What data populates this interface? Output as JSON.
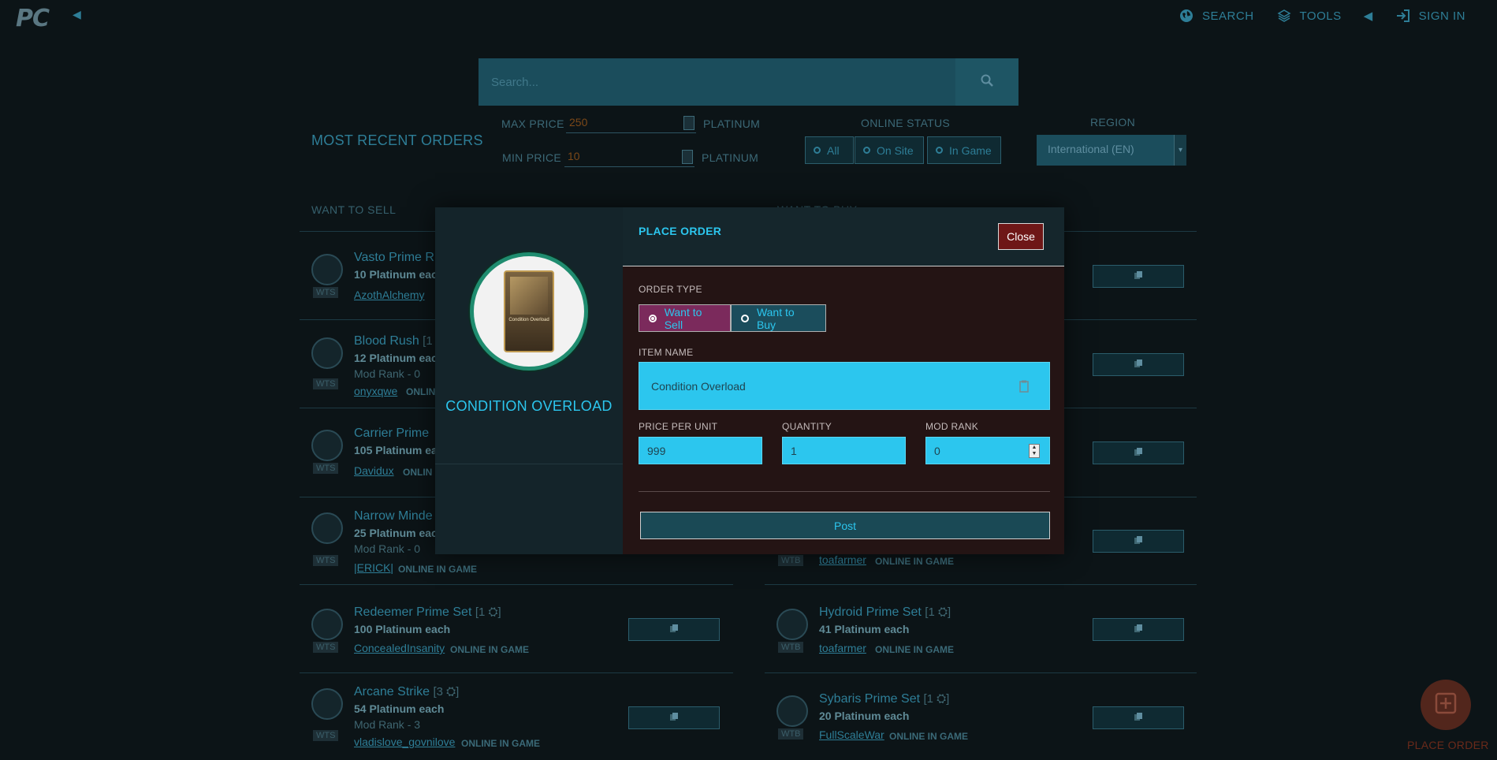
{
  "nav": {
    "logo": "PC",
    "search_label": "SEARCH",
    "tools_label": "TOOLS",
    "signin_label": "SIGN IN"
  },
  "search": {
    "placeholder": "Search..."
  },
  "filters": {
    "max_price_label": "MAX PRICE",
    "max_price_value": "250",
    "min_price_label": "MIN PRICE",
    "min_price_value": "10",
    "unit": "PLATINUM",
    "online_status_label": "ONLINE STATUS",
    "status_options": [
      "All",
      "On Site",
      "In Game"
    ],
    "region_label": "REGION",
    "region_value": "International (EN)"
  },
  "orders": {
    "title": "MOST RECENT ORDERS",
    "sell_header": "WANT TO SELL",
    "buy_header": "WANT TO BUY",
    "sell": [
      {
        "name": "Vasto Prime R",
        "price": "10 Platinum eac",
        "user": "AzothAlchemy",
        "badge": "WTS"
      },
      {
        "name": "Blood Rush",
        "rank": "[1",
        "price": "12 Platinum eac",
        "mod": "Mod Rank - 0",
        "user": "onyxqwe",
        "status": "ONLIN",
        "badge": "WTS"
      },
      {
        "name": "Carrier Prime",
        "price": "105 Platinum ea",
        "user": "Davidux",
        "status": "ONLIN",
        "badge": "WTS"
      },
      {
        "name": "Narrow Minde",
        "price": "25 Platinum eac",
        "mod": "Mod Rank - 0",
        "user": "|ERICK|",
        "status": "ONLINE IN GAME",
        "badge": "WTS"
      },
      {
        "name": "Redeemer Prime Set",
        "rank": "[1 ⛭]",
        "price": "100 Platinum each",
        "user": "ConcealedInsanity",
        "status": "ONLINE IN GAME",
        "badge": "WTS"
      },
      {
        "name": "Arcane Strike",
        "rank": "[3 ⛭]",
        "price": "54 Platinum each",
        "mod": "Mod Rank - 3",
        "user": "vladislove_govnilove",
        "status": "ONLINE IN GAME",
        "badge": "WTS"
      }
    ],
    "buy": [
      {
        "user": "toafarmer",
        "status": "ONLINE IN GAME",
        "badge": "WTB"
      },
      {
        "name": "Hydroid Prime Set",
        "rank": "[1 ⛭]",
        "price": "41 Platinum each",
        "user": "toafarmer",
        "status": "ONLINE IN GAME",
        "badge": "WTB"
      },
      {
        "name": "Sybaris Prime Set",
        "rank": "[1 ⛭]",
        "price": "20 Platinum each",
        "user": "FullScaleWar",
        "status": "ONLINE IN GAME",
        "badge": "WTB"
      }
    ]
  },
  "fab": {
    "label": "PLACE ORDER"
  },
  "modal": {
    "title": "PLACE ORDER",
    "close_label": "Close",
    "item_title": "CONDITION OVERLOAD",
    "card_text": "Condition Overload",
    "order_type_label": "ORDER TYPE",
    "order_types": [
      "Want to Sell",
      "Want to Buy"
    ],
    "selected_order_type": "Want to Sell",
    "item_name_label": "ITEM NAME",
    "item_name_value": "Condition Overload",
    "price_label": "PRICE PER UNIT",
    "price_value": "999",
    "quantity_label": "QUANTITY",
    "quantity_value": "1",
    "mod_rank_label": "MOD RANK",
    "mod_rank_value": "0",
    "post_label": "Post"
  },
  "colors": {
    "accent": "#2cc6ee",
    "sell_active": "#7b2a5c",
    "buy": "#1b4d5c",
    "close": "#6e1717"
  }
}
